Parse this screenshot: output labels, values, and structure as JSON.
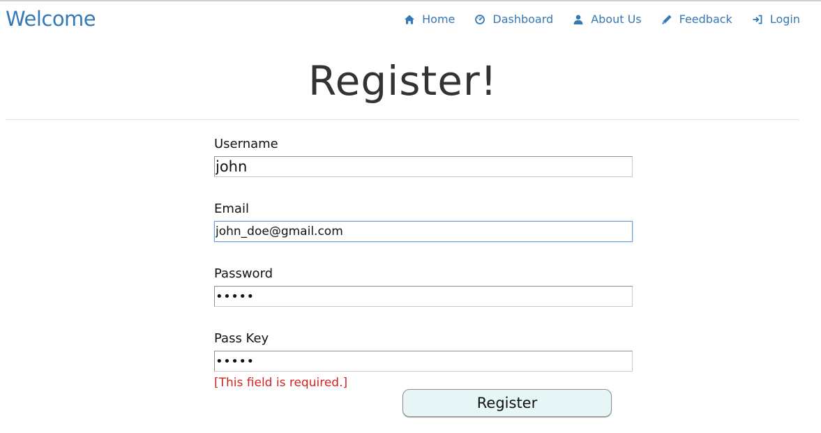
{
  "header": {
    "brand": "Welcome",
    "nav": [
      {
        "label": "Home",
        "icon": "home-icon"
      },
      {
        "label": "Dashboard",
        "icon": "dashboard-icon"
      },
      {
        "label": "About Us",
        "icon": "user-icon"
      },
      {
        "label": "Feedback",
        "icon": "pencil-icon"
      },
      {
        "label": "Login",
        "icon": "login-icon"
      }
    ]
  },
  "main": {
    "title": "Register!",
    "form": {
      "username": {
        "label": "Username",
        "value": "john"
      },
      "email": {
        "label": "Email",
        "value": "john_doe@gmail.com"
      },
      "password": {
        "label": "Password",
        "value": "•••••"
      },
      "passkey": {
        "label": "Pass Key",
        "value": "•••••",
        "error": "[This field is required.]"
      },
      "submit_label": "Register"
    }
  },
  "colors": {
    "accent": "#3478b5",
    "error": "#d2231f",
    "button_bg": "#e6f5f6",
    "focus_border": "#6d9bd1"
  }
}
